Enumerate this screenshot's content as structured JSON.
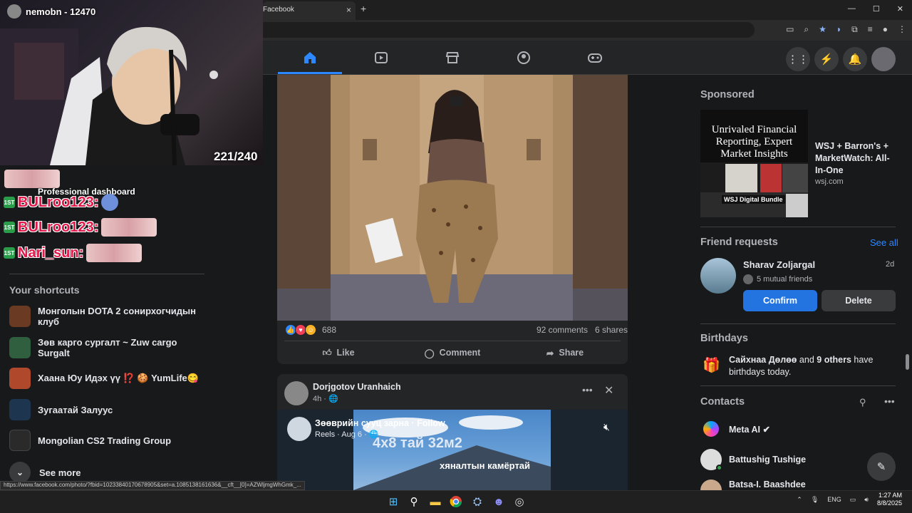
{
  "browser": {
    "tab_title": "Facebook",
    "tab_close": "×",
    "new_tab": "+",
    "window_controls": [
      "—",
      "☐",
      "✕"
    ]
  },
  "stream": {
    "channel_name": "nemobn - 12470",
    "counter": "221/240",
    "chat": [
      {
        "user": "BULroo123:",
        "badge": "1ST"
      },
      {
        "user": "BULroo123:",
        "badge": "1ST"
      },
      {
        "user": "Nari_sun:",
        "badge": "1ST"
      }
    ],
    "overlay_text": "Professional dashboard"
  },
  "sidebar": {
    "shortcuts_heading": "Your shortcuts",
    "shortcuts": [
      {
        "label": "Монголын DOTA 2 сонирхогчидын клуб",
        "color": "#6b3a22"
      },
      {
        "label": "Зөв карго сургалт ~ Zuw cargo Surgalt",
        "color": "#2f5f3f"
      },
      {
        "label": "Хаана Юу Идэх үү ⁉️ 🍪 YumLife😋",
        "color": "#b0482c"
      },
      {
        "label": "Зугаатай Залуус",
        "color": "#1e3550"
      },
      {
        "label": "Mongolian CS2 Trading Group",
        "color": "#2a2a2a"
      }
    ],
    "see_more": "See more"
  },
  "post1": {
    "reaction_count": "688",
    "comments": "92 comments",
    "shares": "6 shares",
    "like_label": "Like",
    "comment_label": "Comment",
    "share_label": "Share"
  },
  "post2": {
    "author": "Dorjgotov Uranhaich",
    "time": "4h · 🌐",
    "reel_page": "Зөөврийн сууц зарна · Follow",
    "reel_meta": "Reels · Aug 6 · 🌐",
    "reel_title": "4x8 тай 32м2",
    "reel_subtitle": "хяналтын камёртай"
  },
  "right": {
    "sponsored_heading": "Sponsored",
    "ad_image_text": "Unrivaled Financial Reporting, Expert Market Insights",
    "ad_badge": "WSJ Digital Bundle",
    "ad_title": "WSJ + Barron's + MarketWatch: All-In-One",
    "ad_url": "wsj.com",
    "friend_requests_heading": "Friend requests",
    "see_all": "See all",
    "friend_name": "Sharav Zoljargal",
    "friend_time": "2d",
    "friend_mutual": "5 mutual friends",
    "confirm": "Confirm",
    "delete": "Delete",
    "birthdays_heading": "Birthdays",
    "birthday_name": "Сайхнаа Дөлөө",
    "birthday_rest": " and ",
    "birthday_others": "9 others",
    "birthday_end": " have birthdays today.",
    "contacts_heading": "Contacts",
    "contacts": [
      {
        "name": "Meta AI ✔",
        "online": false
      },
      {
        "name": "Battushig Tushige",
        "online": true
      },
      {
        "name": "Batsa-I. Baashdee",
        "online": false
      }
    ]
  },
  "status_url": "https://www.facebook.com/photo/?fbid=10233840170678905&set=a.1085138161636&__cft__[0]=AZWljmgWhGmk_...",
  "taskbar": {
    "lang": "ENG",
    "time": "1:27 AM",
    "date": "8/8/2025"
  }
}
